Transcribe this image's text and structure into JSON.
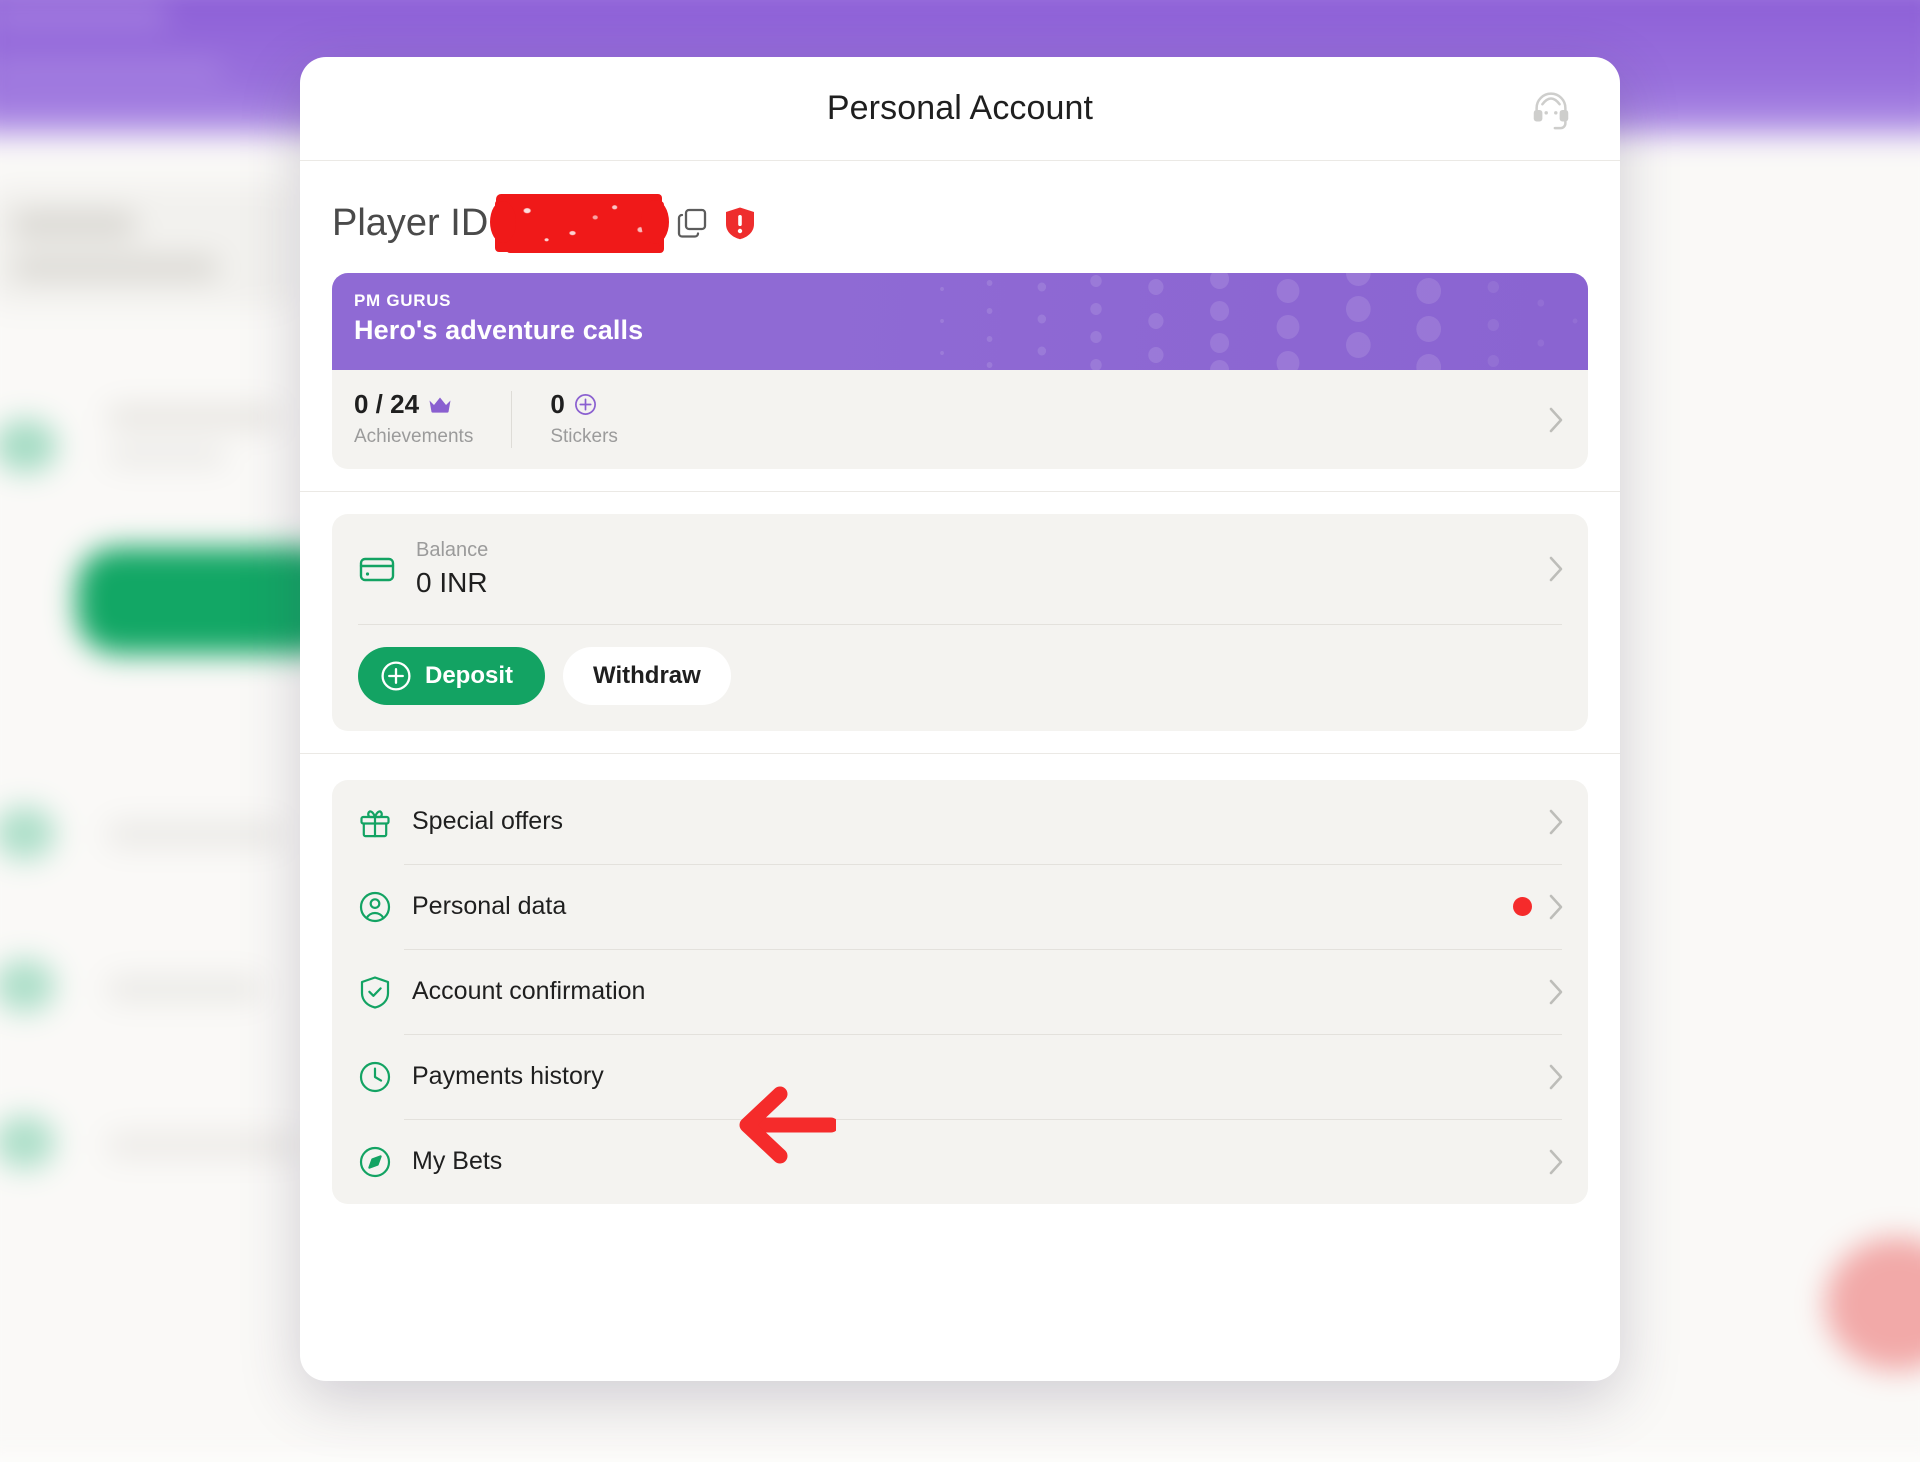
{
  "modal": {
    "title": "Personal Account",
    "support_icon": "support-headset-icon",
    "player": {
      "label": "Player ID",
      "value_redacted": true,
      "copy_icon": "copy-icon",
      "status_icon": "shield-alert-icon"
    },
    "promo": {
      "eyebrow": "PM GURUS",
      "title": "Hero's adventure calls",
      "accent_color": "#8f6ad4",
      "stats": [
        {
          "value": "0 / 24",
          "label": "Achievements",
          "icon": "crown-icon"
        },
        {
          "value": "0",
          "label": "Stickers",
          "icon": "plus-circle-icon"
        }
      ],
      "chevron": "chevron-right-icon"
    },
    "balance": {
      "icon": "credit-card-icon",
      "label": "Balance",
      "amount": "0 INR",
      "chevron": "chevron-right-icon",
      "deposit_label": "Deposit",
      "withdraw_label": "Withdraw",
      "deposit_color": "#13a363"
    },
    "menu": [
      {
        "icon": "gift-icon",
        "label": "Special offers",
        "badge": false
      },
      {
        "icon": "user-circle-icon",
        "label": "Personal data",
        "badge": true
      },
      {
        "icon": "shield-check-icon",
        "label": "Account confirmation",
        "badge": false
      },
      {
        "icon": "clock-icon",
        "label": "Payments history",
        "badge": false
      },
      {
        "icon": "compass-icon",
        "label": "My Bets",
        "badge": false
      }
    ],
    "annotation": {
      "type": "arrow-left",
      "color": "#f52b2b",
      "points_to": "Account confirmation"
    }
  }
}
